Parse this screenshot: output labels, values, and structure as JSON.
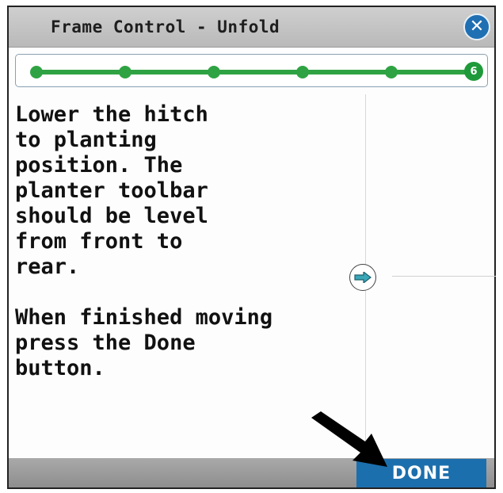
{
  "window": {
    "title": "Frame Control - Unfold",
    "close_icon": "close-icon"
  },
  "progress": {
    "total_steps": 6,
    "current_step": 6,
    "current_step_label": "6",
    "color": "#2fa343"
  },
  "instructions": {
    "text": "Lower the hitch\nto planting\nposition. The\nplanter toolbar\nshould be level\nfrom front to\nrear.\n\nWhen finished moving\npress the Done\nbutton."
  },
  "side_panel": {
    "expand_icon": "arrow-right-icon"
  },
  "footer": {
    "done_label": "DONE",
    "accent": "#1c6fad"
  }
}
